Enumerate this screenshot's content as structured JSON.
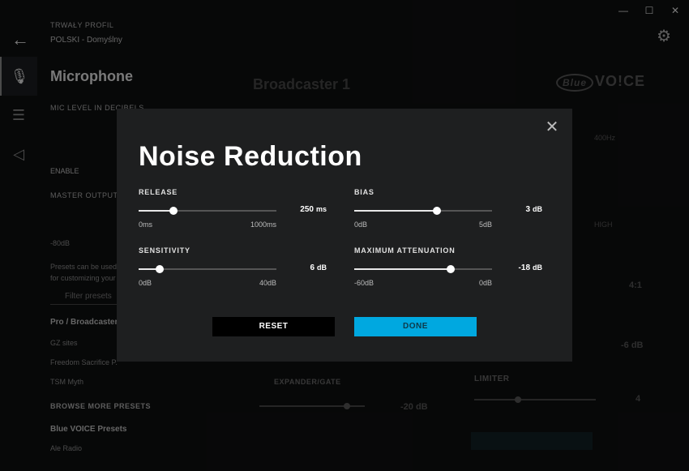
{
  "window": {
    "minimize": "—",
    "maximize": "☐",
    "close": "✕"
  },
  "app": {
    "profile_label": "TRWAŁY PROFIL",
    "profile_value": "POLSKI - Domyślny",
    "title": "Microphone",
    "mic_level": "MIC LEVEL IN DECIBELS",
    "enable": "ENABLE",
    "master_output": "MASTER OUTPUT",
    "db": "-80dB",
    "presets_text": "Presets can be used for customizing your",
    "filter_placeholder": "Filter presets",
    "pro_section": "Pro / Broadcasters",
    "presets": [
      "GZ sites",
      "Freedom Sacrifice P.",
      "TSM Myth"
    ],
    "browse_more": "BROWSE MORE PRESETS",
    "blue_presets": "Blue VOICE Presets",
    "last_preset": "Ale Radio",
    "preset_name": "Broadcaster 1",
    "brand_b": "Blue",
    "brand_voice": "VO!CE",
    "bg_freq": "400Hz",
    "bg_high": "HIGH",
    "bg_ratio": "4:1",
    "bg_thresh": "-6 dB",
    "bg_limiter": "LIMITER",
    "bg_limiter_val": "4",
    "bg_expander": "EXPANDER/GATE",
    "bg_exp_val": "-20 dB"
  },
  "modal": {
    "title": "Noise Reduction",
    "controls": [
      {
        "label": "RELEASE",
        "value": "250",
        "unit": "ms",
        "min": "0ms",
        "max": "1000ms",
        "fraction": 0.25
      },
      {
        "label": "BIAS",
        "value": "3",
        "unit": "dB",
        "min": "0dB",
        "max": "5dB",
        "fraction": 0.6
      },
      {
        "label": "SENSITIVITY",
        "value": "6",
        "unit": "dB",
        "min": "0dB",
        "max": "40dB",
        "fraction": 0.15
      },
      {
        "label": "MAXIMUM ATTENUATION",
        "value": "-18",
        "unit": "dB",
        "min": "-60dB",
        "max": "0dB",
        "fraction": 0.7
      }
    ],
    "reset_label": "RESET",
    "done_label": "DONE"
  },
  "colors": {
    "accent": "#00a8e0",
    "modal_bg": "#1e1f20"
  }
}
